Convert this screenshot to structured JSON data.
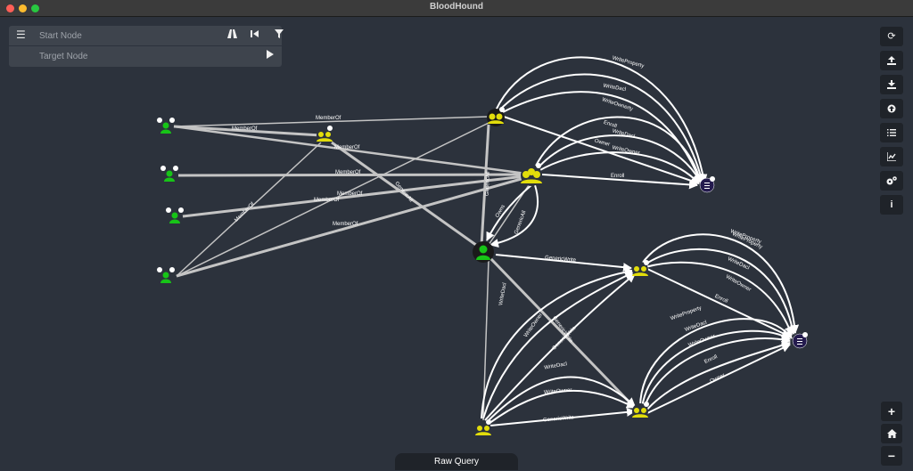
{
  "window": {
    "title": "BloodHound"
  },
  "search": {
    "start_placeholder": "Start Node",
    "target_placeholder": "Target Node",
    "menu_icon": "hamburger-menu-icon",
    "path_icon": "road-icon",
    "back_icon": "step-backward-icon",
    "filter_icon": "filter-icon",
    "play_icon": "play-icon"
  },
  "toolbar": {
    "buttons": [
      "refresh-icon",
      "upload-icon",
      "download-icon",
      "import-icon",
      "query-list-icon",
      "chart-icon",
      "settings-icon",
      "info-icon"
    ]
  },
  "zoom": {
    "in_icon": "plus-icon",
    "home_icon": "home-icon",
    "out_icon": "minus-icon"
  },
  "raw_query": {
    "label": "Raw Query"
  },
  "colors": {
    "background": "#2c323c",
    "user_node": "#17c417",
    "group_node": "#e2dd0b",
    "template_node": "#241b4e",
    "edge_gray": "#b8b8b8",
    "edge_white": "#ffffff"
  },
  "graph": {
    "nodes": [
      {
        "id": "u1",
        "type": "user"
      },
      {
        "id": "u2",
        "type": "user"
      },
      {
        "id": "u3",
        "type": "user"
      },
      {
        "id": "u4",
        "type": "user"
      },
      {
        "id": "g1",
        "type": "group"
      },
      {
        "id": "gA",
        "type": "group"
      },
      {
        "id": "gB",
        "type": "group"
      },
      {
        "id": "uC",
        "type": "user"
      },
      {
        "id": "gD",
        "type": "group"
      },
      {
        "id": "gE",
        "type": "group"
      },
      {
        "id": "gF",
        "type": "group"
      },
      {
        "id": "t1",
        "type": "certtemplate"
      },
      {
        "id": "t2",
        "type": "certtemplate"
      }
    ],
    "edge_labels": [
      "MemberOf",
      "MemberOf",
      "MemberOf",
      "MemberOf",
      "MemberOf",
      "MemberOf",
      "MemberOf",
      "MemberOf",
      "GenericAll",
      "GenericAll",
      "Owns",
      "GenericAll",
      "WriteProperty",
      "WriteDacl",
      "WriteOwnerty",
      "Enroll",
      "WriteDacl",
      "Owner",
      "WriteOwner",
      "Enroll",
      "GenericWrite",
      "GenericWrite",
      "WriteOwner",
      "WriteDacl",
      "GenericWrite",
      "WriteDacl",
      "WriteOwner",
      "GenericWrite",
      "WriteProperty",
      "WriteProperty",
      "WriteDacl",
      "WriteOwner",
      "Enroll",
      "WriteProperty",
      "WriteDacl",
      "WriteOwner",
      "Enroll",
      "Owner"
    ]
  }
}
